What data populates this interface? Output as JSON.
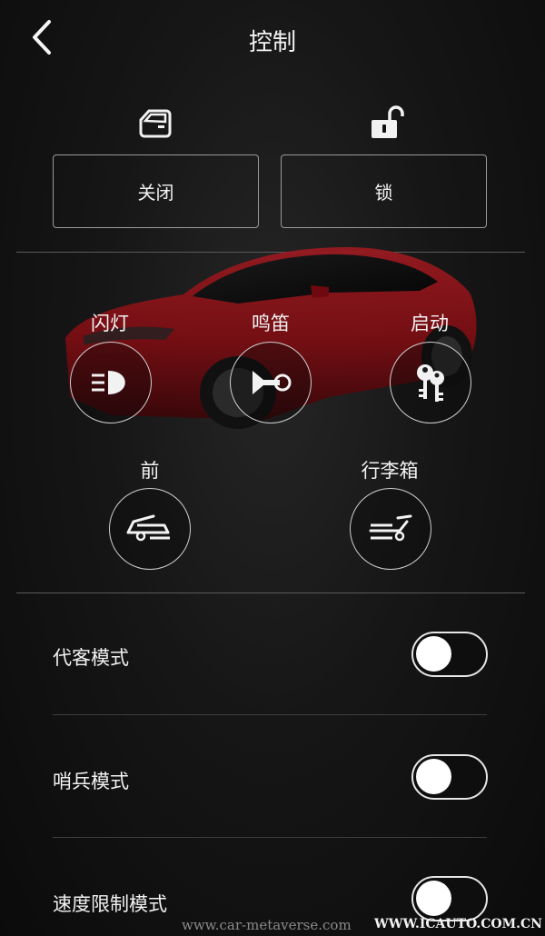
{
  "header": {
    "title": "控制",
    "back_icon": "chevron-left-icon"
  },
  "top_actions": [
    {
      "label": "关闭",
      "icon": "car-door-icon"
    },
    {
      "label": "锁",
      "icon": "unlock-icon"
    }
  ],
  "controls": {
    "flash": {
      "label": "闪灯",
      "icon": "headlight-icon"
    },
    "horn": {
      "label": "鸣笛",
      "icon": "horn-icon"
    },
    "start": {
      "label": "启动",
      "icon": "keys-icon"
    },
    "frunk": {
      "label": "前",
      "icon": "frunk-icon"
    },
    "trunk": {
      "label": "行李箱",
      "icon": "trunk-icon"
    }
  },
  "modes": [
    {
      "label": "代客模式",
      "enabled": false
    },
    {
      "label": "哨兵模式",
      "enabled": false
    },
    {
      "label": "速度限制模式",
      "enabled": false
    }
  ],
  "watermarks": {
    "left": "www.car-metaverse.com",
    "right": "WWW.ICAUTO.COM.CN"
  },
  "colors": {
    "background": "#0d0d0d",
    "car_body": "#8a0f14",
    "border": "#9a9a9a"
  }
}
